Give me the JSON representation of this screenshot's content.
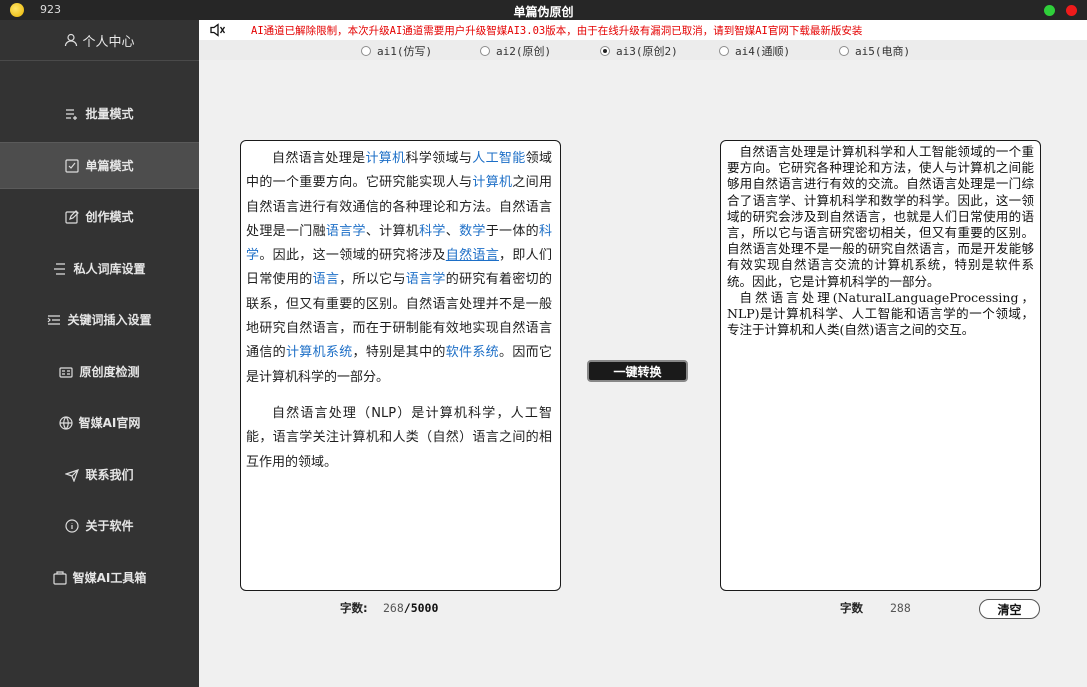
{
  "titlebar": {
    "count": "923",
    "title": "单篇伪原创"
  },
  "sidebar": {
    "profile_label": "个人中心",
    "items": [
      {
        "label": "批量模式",
        "icon": "list-add-icon"
      },
      {
        "label": "单篇模式",
        "icon": "checkbox-icon"
      },
      {
        "label": "创作模式",
        "icon": "edit-icon"
      },
      {
        "label": "私人词库设置",
        "icon": "lines-icon"
      },
      {
        "label": "关键词插入设置",
        "icon": "insert-icon"
      },
      {
        "label": "原创度检测",
        "icon": "card-icon"
      },
      {
        "label": "智媒AI官网",
        "icon": "globe-icon"
      },
      {
        "label": "联系我们",
        "icon": "paper-plane-icon"
      },
      {
        "label": "关于软件",
        "icon": "info-icon"
      },
      {
        "label": "智媒AI工具箱",
        "icon": "toolbox-icon"
      }
    ],
    "active_index": 1
  },
  "notice": {
    "text": "AI通道已解除限制，本次升级AI通道需要用户升级智媒AI3.03版本，由于在线升级有漏洞已取消，请到智媒AI官网下载最新版安装",
    "color": "#e40000"
  },
  "modes": [
    {
      "label": "ai1(仿写)",
      "checked": false
    },
    {
      "label": "ai2(原创)",
      "checked": false
    },
    {
      "label": "ai3(原创2)",
      "checked": true
    },
    {
      "label": "ai4(通顺)",
      "checked": false
    },
    {
      "label": "ai5(电商)",
      "checked": false
    }
  ],
  "source": {
    "paragraphs": [
      [
        {
          "t": "自然语言处理是"
        },
        {
          "t": "计算机",
          "link": true
        },
        {
          "t": "科学领域与"
        },
        {
          "t": "人工智能",
          "link": true
        },
        {
          "t": "领域中的一个重要方向。它研究能实现人与"
        },
        {
          "t": "计算机",
          "link": true
        },
        {
          "t": "之间用自然语言进行有效通信的各种理论和方法。自然语言处理是一门融"
        },
        {
          "t": "语言学",
          "link": true
        },
        {
          "t": "、计算机"
        },
        {
          "t": "科学",
          "link": true
        },
        {
          "t": "、"
        },
        {
          "t": "数学",
          "link": true
        },
        {
          "t": "于一体的"
        },
        {
          "t": "科学",
          "link": true
        },
        {
          "t": "。因此，这一领域的研究将涉及"
        },
        {
          "t": "自然语言",
          "link": true,
          "underline": true
        },
        {
          "t": "，即人们日常使用的"
        },
        {
          "t": "语言",
          "link": true
        },
        {
          "t": "，所以它与"
        },
        {
          "t": "语言学",
          "link": true
        },
        {
          "t": "的研究有着密切的联系，但又有重要的区别。自然语言处理并不是一般地研究自然语言，而在于研制能有效地实现自然语言通信的"
        },
        {
          "t": "计算机系统",
          "link": true
        },
        {
          "t": "，特别是其中的"
        },
        {
          "t": "软件系统",
          "link": true
        },
        {
          "t": "。因而它是计算机科学的一部分。"
        }
      ],
      [
        {
          "t": "自然语言处理（NLP）是计算机科学，人工智能，语言学关注计算机和人类（自然）语言之间的相互作用的领域。"
        }
      ]
    ],
    "count_label": "字数:",
    "count": "268",
    "max": "/5000"
  },
  "output": {
    "paragraphs": [
      "自然语言处理是计算机科学和人工智能领域的一个重要方向。它研究各种理论和方法，使人与计算机之间能够用自然语言进行有效的交流。自然语言处理是一门综合了语言学、计算机科学和数学的科学。因此，这一领域的研究会涉及到自然语言，也就是人们日常使用的语言，所以它与语言研究密切相关，但又有重要的区别。自然语言处理不是一般的研究自然语言，而是开发能够有效实现自然语言交流的计算机系统，特别是软件系统。因此，它是计算机科学的一部分。",
      "自然语言处理(NaturalLanguageProcessing，NLP)是计算机科学、人工智能和语言学的一个领域，专注于计算机和人类(自然)语言之间的交互。"
    ],
    "count_label": "字数",
    "count": "288"
  },
  "actions": {
    "convert_label": "一键转换",
    "clear_label": "清空"
  }
}
